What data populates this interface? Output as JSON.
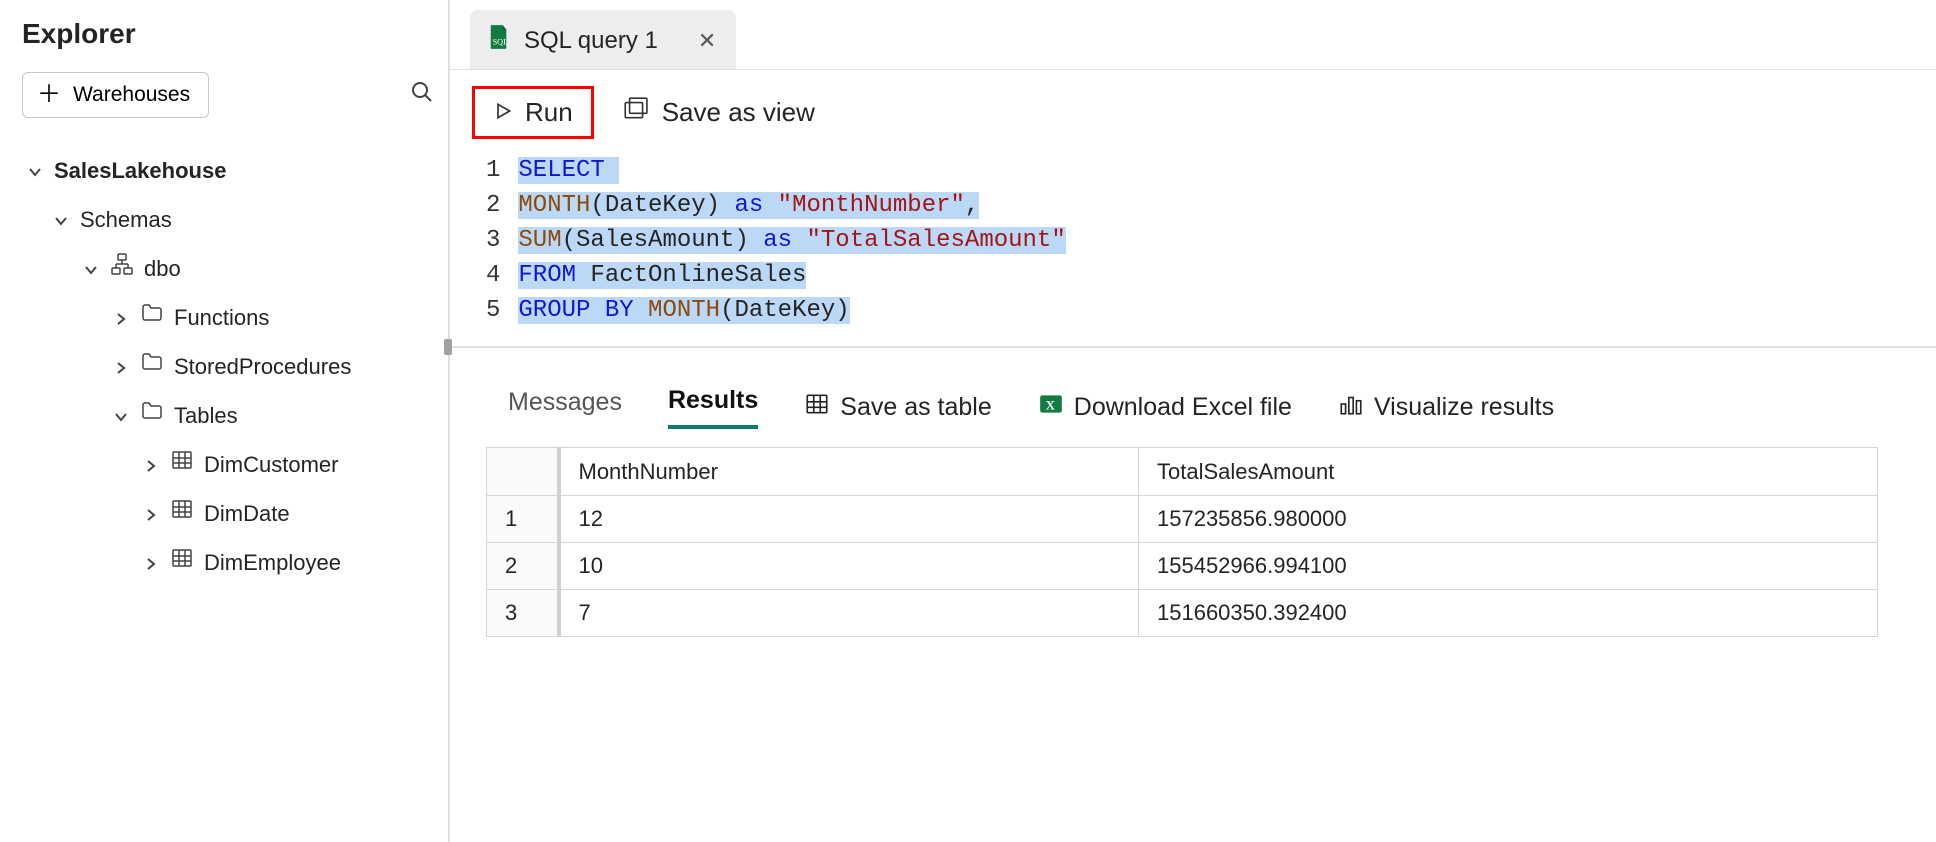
{
  "explorer": {
    "title": "Explorer",
    "warehouses_button": "Warehouses",
    "tree": {
      "root": "SalesLakehouse",
      "schemas_label": "Schemas",
      "dbo_label": "dbo",
      "functions_label": "Functions",
      "storedprocs_label": "StoredProcedures",
      "tables_label": "Tables",
      "tables": [
        "DimCustomer",
        "DimDate",
        "DimEmployee"
      ]
    }
  },
  "tab": {
    "label": "SQL query 1"
  },
  "toolbar": {
    "run": "Run",
    "save_as_view": "Save as view"
  },
  "code_lines": [
    "1",
    "2",
    "3",
    "4",
    "5"
  ],
  "code": {
    "l1": {
      "kw_select": "SELECT"
    },
    "l2": {
      "fn_month": "MONTH",
      "arg": "(DateKey)",
      "kw_as": "as",
      "alias": "\"MonthNumber\"",
      "comma": ","
    },
    "l3": {
      "fn_sum": "SUM",
      "arg": "(SalesAmount)",
      "kw_as": "as",
      "alias": "\"TotalSalesAmount\""
    },
    "l4": {
      "kw_from": "FROM",
      "tbl": " FactOnlineSales"
    },
    "l5": {
      "kw_group": "GROUP",
      "kw_by": "BY",
      "fn_month": "MONTH",
      "arg": "(DateKey)"
    }
  },
  "results": {
    "tabs": {
      "messages": "Messages",
      "results": "Results"
    },
    "actions": {
      "save_table": "Save as table",
      "download_excel": "Download Excel file",
      "visualize": "Visualize results"
    },
    "columns": [
      "MonthNumber",
      "TotalSalesAmount"
    ],
    "rows": [
      {
        "n": "1",
        "c0": "12",
        "c1": "157235856.980000"
      },
      {
        "n": "2",
        "c0": "10",
        "c1": "155452966.994100"
      },
      {
        "n": "3",
        "c0": "7",
        "c1": "151660350.392400"
      }
    ]
  }
}
